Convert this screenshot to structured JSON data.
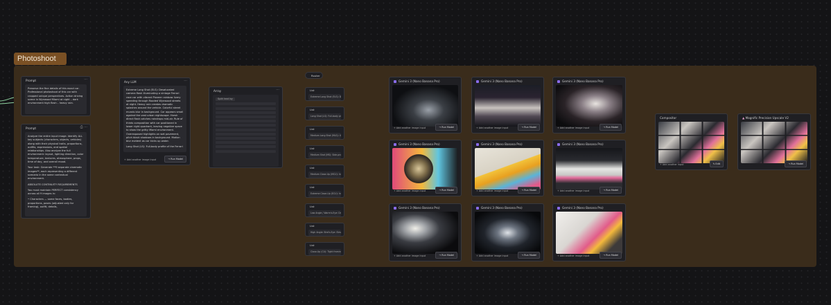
{
  "group": {
    "title": "Photoshoot"
  },
  "prompt1": {
    "title": "Prompt",
    "text": "Preserve the fine details of this exact car. Professional photoshoot of this car with cropped unique perspectives. Action driving scene in Wynwood Miami at night – dark environment high flash – heavy rain."
  },
  "prompt2": {
    "title": "Prompt",
    "text": "Analyze the entire input image. Identify ALL key subjects (characters, objects, vehicles) along with their physical traits, proportions, outfits, expressions, and spatial relationships. Also analyze the full environment: layout, lighting direction, color temperature, textures, atmosphere, props, time of day, and overall mood.",
    "text2": "Your task: Generate **9 separate cinematic images**, each representing a different scenario in the same contextual environment.",
    "heading": "ABSOLUTE CONTINUITY REQUIREMENTS",
    "text3": "You must maintain PERFECT consistency across all 9 images in:",
    "text4": "• Characters — same faces, bodies, proportions, poses (adjusted only for framing), outfit, details,"
  },
  "any_llm": {
    "title": "Any LLM",
    "text": "Extreme Long Shot (ELS): Desaturated camera flash illuminating a vintage Ferrari race car with vibrant Pioneer rainbow livery speeding through flooded Wynwood streets at night. Heavy rain creates dramatic splashes around the vehicle. Colorful street murals blur in background. Car appears small against the vast urban nightscape. Harsh direct flash catches raindrops mid-air. Rule of thirds composition with car positioned in lower right quadrant, leaving negative space to show the gritty Miami environment. Overexposed highlights on wet pavement, pitch black shadows in background. Motion blur evident as car kicks up water.",
    "text2": "Long Shot (LS): Full-body profile of the Ferrari",
    "add_input": "Add another image input",
    "run": "Run Model"
  },
  "array": {
    "title": "Array",
    "chip": "Split text by"
  },
  "router": {
    "title": "Router"
  },
  "lists": [
    {
      "title": "List",
      "text": "Extreme Long Shot (ELS): Despera..."
    },
    {
      "title": "List",
      "text": "Long Shot (LS): Full-body profile..."
    },
    {
      "title": "List",
      "text": "Medium Long Shot (MLS): Ultra-w..."
    },
    {
      "title": "List",
      "text": "Medium Shot (MS): Side-profile..."
    },
    {
      "title": "List",
      "text": "Medium Close-Up (MCU): Interior..."
    },
    {
      "title": "List",
      "text": "Extreme Close-Up (ECU): Intense..."
    },
    {
      "title": "List",
      "text": "Low Angle / Worm's-Eye: Dramat..."
    },
    {
      "title": "List",
      "text": "High Angle: Bird's-Eye: Elevated..."
    },
    {
      "title": "List",
      "text": "Close-Up (CU): Tight framing on..."
    }
  ],
  "gen": {
    "title": "Gemini 3 (Nano Banana Pro)",
    "add_input": "Add another image input",
    "run": "Run Model"
  },
  "compositor": {
    "title": "Compositor",
    "add_input": "Add another input",
    "edit": "Edit"
  },
  "upscale": {
    "title": "Magnific Precision Upscale V2",
    "run": "Run Model"
  },
  "colors": {
    "group": "#3a2c1b",
    "label": "#7a5024",
    "wire_green": "#8fd3a0",
    "wire_purple": "#7b6cff",
    "wire_pink": "#e58fc4"
  }
}
